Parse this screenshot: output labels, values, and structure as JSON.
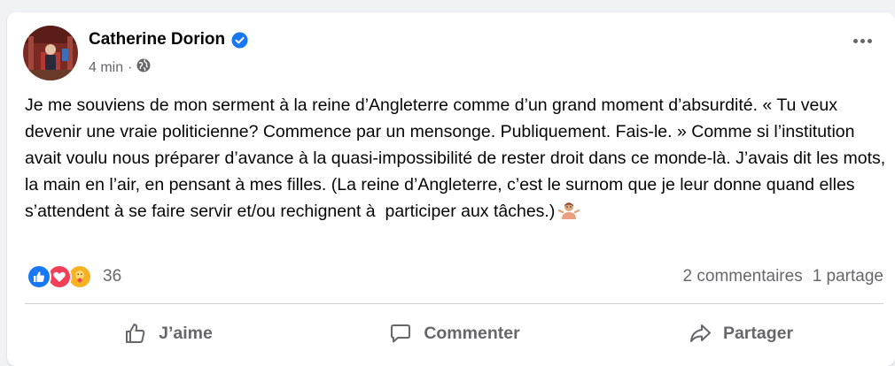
{
  "post": {
    "author": "Catherine Dorion",
    "time": "4 min",
    "separator": "·",
    "text": "Je me souviens de mon serment à la reine d’Angleterre comme d’un grand moment d’absurdité. « Tu veux devenir une vraie politicienne? Commence par un mensonge. Publiquement. Fais-le. » Comme si l’institution avait voulu nous préparer d’avance à la quasi-impossibilité de rester droit dans ce monde-là. J’avais dit les mots, la main en l’air, en pensant à mes filles. (La reine d’Angleterre, c’est le surnom que je leur donne quand elles s’attendent à se faire servir et/ou rechignent à  participer aux tâches.)"
  },
  "stats": {
    "reaction_count": "36",
    "comments": "2 commentaires",
    "shares": "1 partage"
  },
  "actions": {
    "like": "J’aime",
    "comment": "Commenter",
    "share": "Partager"
  },
  "icons": {
    "verified": "verified-badge-icon",
    "globe": "globe-icon",
    "more": "more-options-icon",
    "like": "thumbs-up-icon",
    "comment": "comment-bubble-icon",
    "share": "share-arrow-icon"
  },
  "colors": {
    "brand_blue": "#1877f2",
    "love_red": "#f33e58",
    "care_yellow": "#f7b125",
    "secondary_text": "#65676b"
  }
}
